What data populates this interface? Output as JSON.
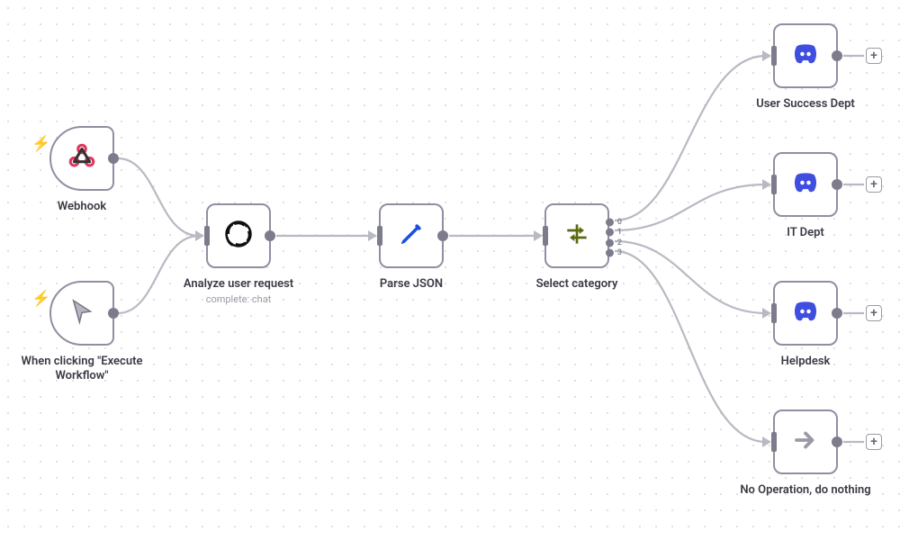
{
  "nodes": {
    "webhook": {
      "label": "Webhook"
    },
    "manual": {
      "label": "When clicking \"Execute Workflow\""
    },
    "analyze": {
      "label": "Analyze user request",
      "sublabel": "complete: chat"
    },
    "parse": {
      "label": "Parse JSON"
    },
    "select": {
      "label": "Select category",
      "port_labels": [
        "0",
        "1",
        "2",
        "3"
      ]
    },
    "discord0": {
      "label": "User Success Dept"
    },
    "discord1": {
      "label": "IT Dept"
    },
    "discord2": {
      "label": "Helpdesk"
    },
    "noop": {
      "label": "No Operation, do nothing"
    }
  },
  "icons": {
    "webhook": "webhook",
    "manual": "cursor",
    "analyze": "openai",
    "parse": "pencil",
    "select": "switch",
    "discord": "discord",
    "noop": "arrow-right"
  },
  "colors": {
    "node_border": "#8f8fa3",
    "wire": "#b9b9c4",
    "bolt": "#ff3a55",
    "pencil": "#1a4fe0",
    "switch": "#5a6a10",
    "discord": "#404ee0",
    "arrow": "#9a9aa6"
  }
}
